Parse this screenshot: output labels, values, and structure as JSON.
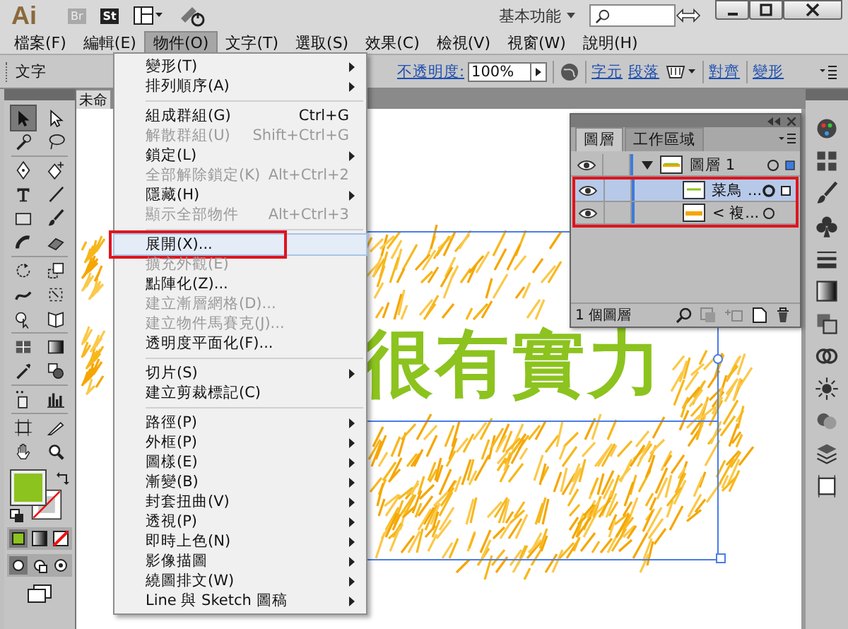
{
  "app_bar": {
    "logo": "Ai",
    "bridge": "Br",
    "stock": "St",
    "workspace": "基本功能"
  },
  "menu_bar": [
    {
      "label": "檔案(F)",
      "selected": false
    },
    {
      "label": "編輯(E)",
      "selected": false
    },
    {
      "label": "物件(O)",
      "selected": true
    },
    {
      "label": "文字(T)",
      "selected": false
    },
    {
      "label": "選取(S)",
      "selected": false
    },
    {
      "label": "效果(C)",
      "selected": false
    },
    {
      "label": "檢視(V)",
      "selected": false
    },
    {
      "label": "視窗(W)",
      "selected": false
    },
    {
      "label": "說明(H)",
      "selected": false
    }
  ],
  "control_bar": {
    "tool_label": "文字",
    "opacity_label": "不透明度:",
    "opacity_value": "100%",
    "links": [
      "字元",
      "段落",
      "對齊",
      "變形"
    ]
  },
  "document": {
    "tab": "未命",
    "artwork_text": "很有實力"
  },
  "toolbox": {
    "tools": [
      {
        "selected": true
      },
      {
        "selected": false
      },
      {
        "selected": false
      },
      {
        "selected": false
      },
      {
        "selected": false
      },
      {
        "selected": false
      },
      {
        "selected": false
      },
      {
        "selected": false
      },
      {
        "selected": false
      },
      {
        "selected": false
      },
      {
        "selected": false
      },
      {
        "selected": false
      },
      {
        "selected": false
      },
      {
        "selected": false
      },
      {
        "selected": false
      },
      {
        "selected": false
      },
      {
        "selected": false
      },
      {
        "selected": false
      },
      {
        "selected": false
      },
      {
        "selected": false
      },
      {
        "selected": false
      },
      {
        "selected": false
      },
      {
        "selected": false
      },
      {
        "selected": false
      },
      {
        "selected": false
      },
      {
        "selected": false
      },
      {
        "selected": false
      },
      {
        "selected": false
      }
    ],
    "fill": {
      "color": "#8cc31f"
    }
  },
  "object_menu": {
    "groups": [
      [
        {
          "label": "變形(T)",
          "submenu": true,
          "disabled": false,
          "selected": false,
          "annotated": false
        },
        {
          "label": "排列順序(A)",
          "submenu": true,
          "disabled": false,
          "selected": false,
          "annotated": false
        }
      ],
      [
        {
          "label": "組成群組(G)",
          "shortcut": "Ctrl+G",
          "submenu": false,
          "disabled": false,
          "selected": false,
          "annotated": false
        },
        {
          "label": "解散群組(U)",
          "shortcut": "Shift+Ctrl+G",
          "submenu": false,
          "disabled": true,
          "selected": false,
          "annotated": false
        },
        {
          "label": "鎖定(L)",
          "submenu": true,
          "disabled": false,
          "selected": false,
          "annotated": false
        },
        {
          "label": "全部解除鎖定(K)",
          "shortcut": "Alt+Ctrl+2",
          "submenu": false,
          "disabled": true,
          "selected": false,
          "annotated": false
        },
        {
          "label": "隱藏(H)",
          "submenu": true,
          "disabled": false,
          "selected": false,
          "annotated": false
        },
        {
          "label": "顯示全部物件",
          "shortcut": "Alt+Ctrl+3",
          "submenu": false,
          "disabled": true,
          "selected": false,
          "annotated": false
        }
      ],
      [
        {
          "label": "展開(X)...",
          "submenu": false,
          "disabled": false,
          "selected": true,
          "annotated": true
        },
        {
          "label": "擴充外觀(E)",
          "submenu": false,
          "disabled": true,
          "selected": false,
          "annotated": false
        },
        {
          "label": "點陣化(Z)...",
          "submenu": false,
          "disabled": false,
          "selected": false,
          "annotated": false
        },
        {
          "label": "建立漸層網格(D)...",
          "submenu": false,
          "disabled": true,
          "selected": false,
          "annotated": false
        },
        {
          "label": "建立物件馬賽克(J)...",
          "submenu": false,
          "disabled": true,
          "selected": false,
          "annotated": false
        },
        {
          "label": "透明度平面化(F)...",
          "submenu": false,
          "disabled": false,
          "selected": false,
          "annotated": false
        }
      ],
      [
        {
          "label": "切片(S)",
          "submenu": true,
          "disabled": false,
          "selected": false,
          "annotated": false
        },
        {
          "label": "建立剪裁標記(C)",
          "submenu": false,
          "disabled": false,
          "selected": false,
          "annotated": false
        }
      ],
      [
        {
          "label": "路徑(P)",
          "submenu": true,
          "disabled": false,
          "selected": false,
          "annotated": false
        },
        {
          "label": "外框(P)",
          "submenu": true,
          "disabled": false,
          "selected": false,
          "annotated": false
        },
        {
          "label": "圖樣(E)",
          "submenu": true,
          "disabled": false,
          "selected": false,
          "annotated": false
        },
        {
          "label": "漸變(B)",
          "submenu": true,
          "disabled": false,
          "selected": false,
          "annotated": false
        },
        {
          "label": "封套扭曲(V)",
          "submenu": true,
          "disabled": false,
          "selected": false,
          "annotated": false
        },
        {
          "label": "透視(P)",
          "submenu": true,
          "disabled": false,
          "selected": false,
          "annotated": false
        },
        {
          "label": "即時上色(N)",
          "submenu": true,
          "disabled": false,
          "selected": false,
          "annotated": false
        },
        {
          "label": "影像描圖",
          "submenu": true,
          "disabled": false,
          "selected": false,
          "annotated": false
        },
        {
          "label": "繞圖排文(W)",
          "submenu": true,
          "disabled": false,
          "selected": false,
          "annotated": false
        },
        {
          "label": "Line 與 Sketch 圖稿",
          "submenu": true,
          "disabled": false,
          "selected": false,
          "annotated": false
        }
      ]
    ]
  },
  "layers_panel": {
    "tabs": [
      {
        "label": "圖層",
        "selected": true
      },
      {
        "label": "工作區域",
        "selected": false
      }
    ],
    "layer": {
      "name": "圖層 1",
      "expanded": true,
      "children": [
        {
          "name": "菜鳥 ...",
          "selected": true
        },
        {
          "name": "< 複...",
          "selected": false
        }
      ]
    },
    "children_annotated": true,
    "footer": "1 個圖層"
  }
}
